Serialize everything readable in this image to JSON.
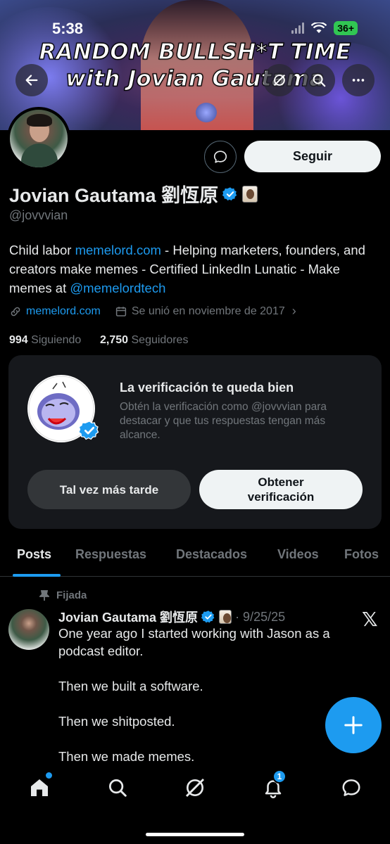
{
  "status_bar": {
    "time": "5:38",
    "battery": "36+"
  },
  "banner": {
    "line1": "RANDOM BULLSH*T TIME",
    "line2": "with Jovian Gautama"
  },
  "profile": {
    "name": "Jovian Gautama 劉恆原",
    "handle": "@jovvvian",
    "follow_label": "Seguir",
    "bio_prefix": "Child labor ",
    "bio_link1": "memelord.com",
    "bio_middle": " - Helping marketers, founders, and creators make memes - Certified LinkedIn Lunatic - Make memes at ",
    "bio_link2": "@memelordtech",
    "website": "memelord.com",
    "joined": "Se unió en noviembre de 2017",
    "following_count": "994",
    "following_label": "Siguiendo",
    "followers_count": "2,750",
    "followers_label": "Seguidores"
  },
  "verification_card": {
    "title": "La verificación te queda bien",
    "description": "Obtén la verificación como @jovvvian para destacar y que tus respuestas tengan más alcance.",
    "later_label": "Tal vez más tarde",
    "get_label": "Obtener verificación"
  },
  "tabs": [
    "Posts",
    "Respuestas",
    "Destacados",
    "Videos",
    "Fotos"
  ],
  "post": {
    "pinned_label": "Fijada",
    "author": "Jovian Gautama 劉恆原",
    "date": "· 9/25/25",
    "paragraphs": [
      "One year ago I started working with Jason as a podcast editor.",
      "Then we built a software.",
      "Then we shitposted.",
      "Then we made memes."
    ]
  },
  "nav": {
    "notifications_badge": "1"
  },
  "colors": {
    "accent": "#1d9bf0",
    "background": "#000000",
    "muted": "#71767b"
  }
}
